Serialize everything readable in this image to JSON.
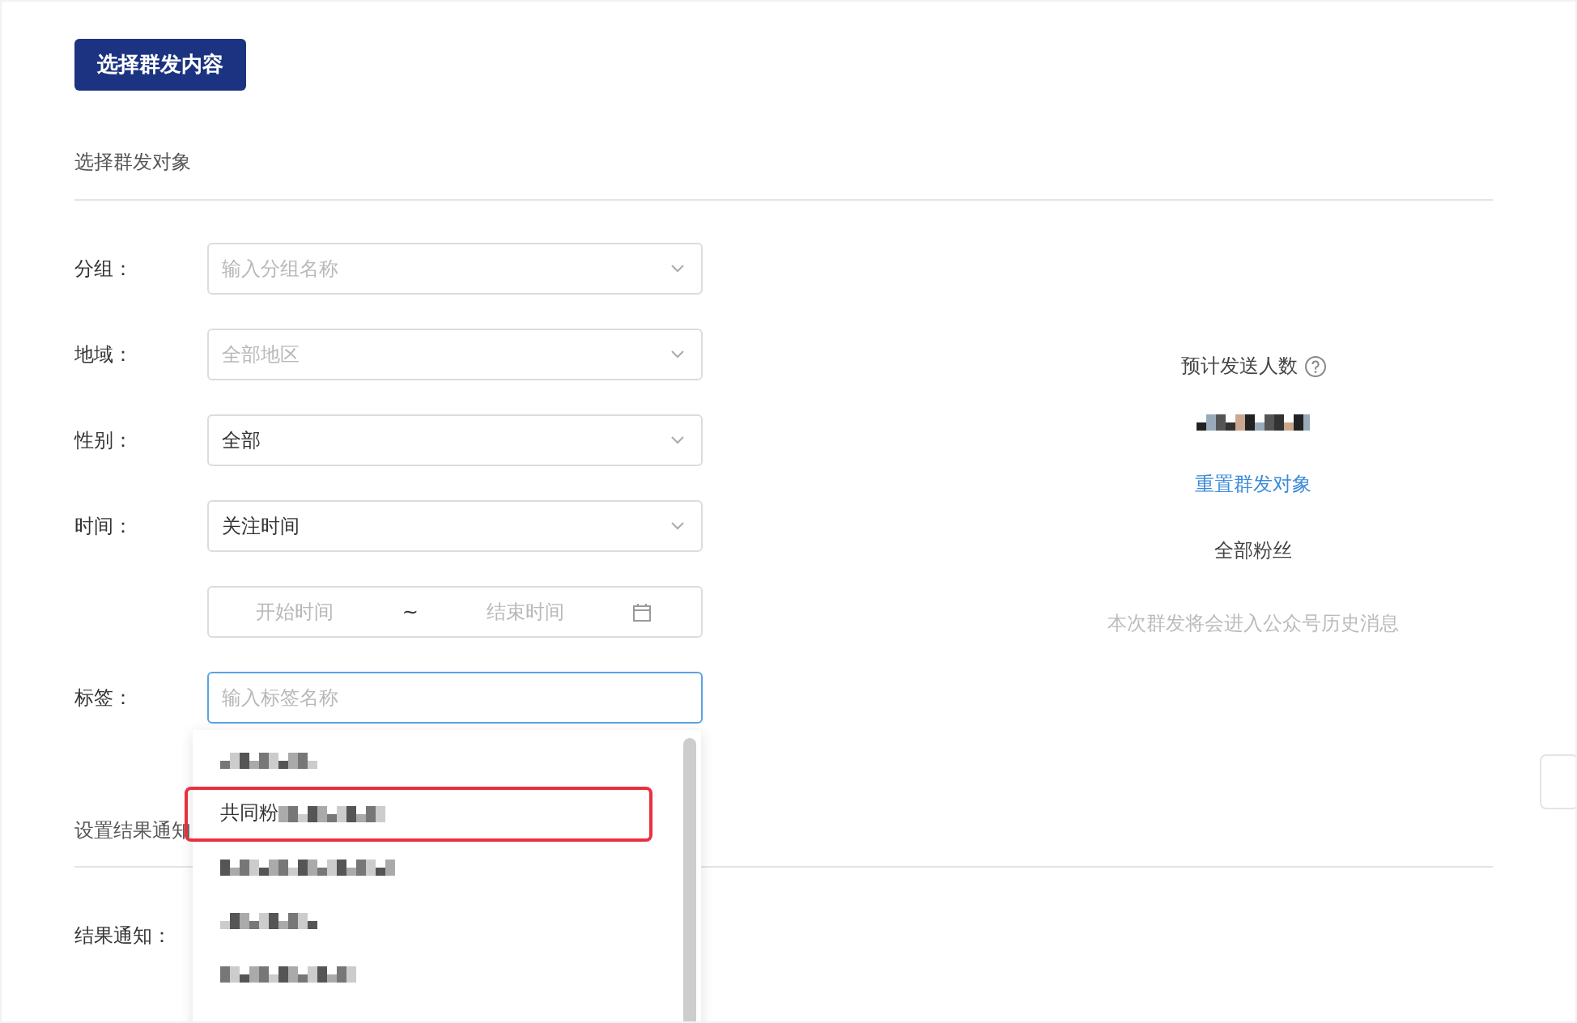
{
  "primary_button": "选择群发内容",
  "section_title": "选择群发对象",
  "fields": [
    {
      "kind": "select",
      "label": "分组：",
      "placeholder": "输入分组名称"
    },
    {
      "kind": "select",
      "label": "地域：",
      "placeholder": "全部地区"
    },
    {
      "kind": "select",
      "label": "性别：",
      "value": "全部"
    },
    {
      "kind": "select",
      "label": "时间：",
      "value": "关注时间"
    },
    {
      "kind": "daterange",
      "start_placeholder": "开始时间",
      "separator": "~",
      "end_placeholder": "结束时间"
    },
    {
      "kind": "text",
      "label": "标签：",
      "placeholder": "输入标签名称",
      "focused": true
    }
  ],
  "dropdown": {
    "items": [
      {
        "kind": "redacted",
        "annotated": false
      },
      {
        "kind": "partial",
        "text": "共同粉",
        "annotated": true
      },
      {
        "kind": "redacted",
        "annotated": false
      },
      {
        "kind": "redacted",
        "annotated": false
      },
      {
        "kind": "redacted",
        "annotated": false
      }
    ]
  },
  "summary": {
    "title": "预计发送人数",
    "reset_link": "重置群发对象",
    "audience": "全部粉丝",
    "note": "本次群发将会进入公众号历史消息"
  },
  "result_section": {
    "title": "设置结果通知",
    "label": "结果通知："
  }
}
